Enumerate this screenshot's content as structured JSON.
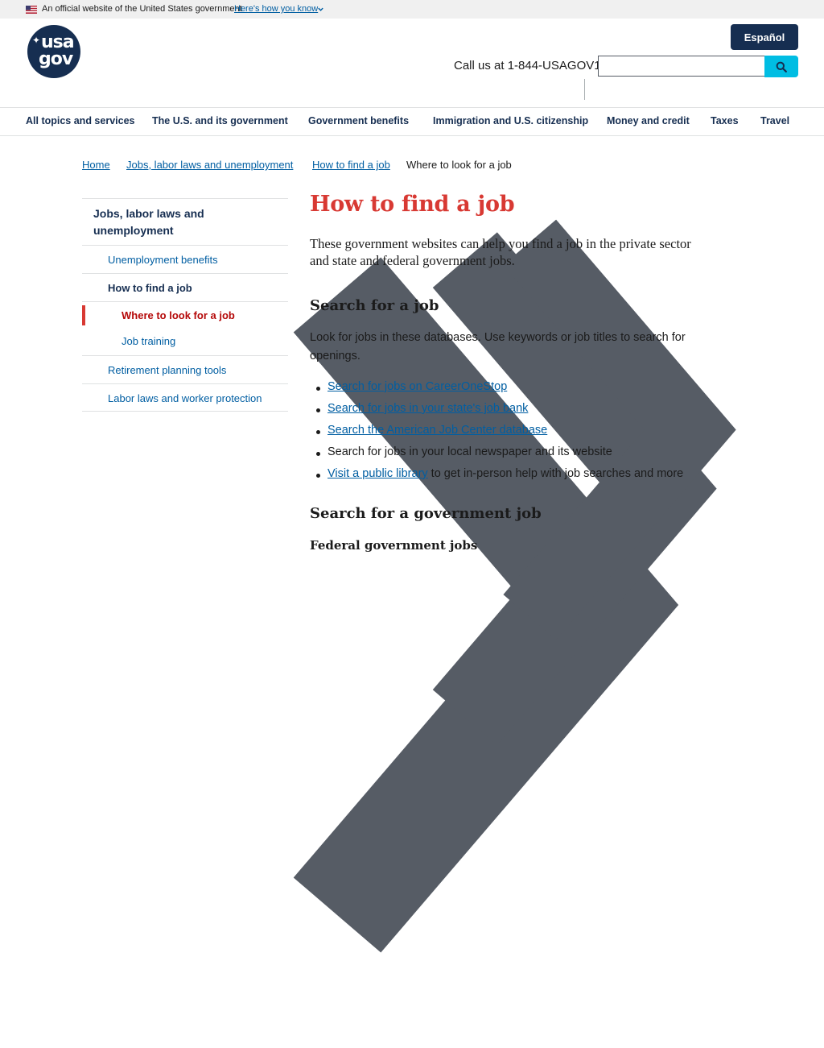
{
  "banner": {
    "official_text": "An official website of the United States government",
    "how_link": "Here's how you know"
  },
  "header": {
    "logo_top": "usa",
    "logo_bottom": "gov",
    "espanol_label": "Español",
    "call_text": "Call us at 1-844-USAGOV1",
    "search_value": ""
  },
  "nav": {
    "items": [
      "All topics and services",
      "The U.S. and its government",
      "Government benefits",
      "Immigration and U.S. citizenship",
      "Money and credit",
      "Taxes",
      "Travel"
    ]
  },
  "breadcrumb": {
    "items": [
      "Home",
      "Jobs, labor laws and unemployment",
      "How to find a job"
    ],
    "current": "Where to look for a job"
  },
  "sidebar": {
    "heading_line1": "Jobs, labor laws and",
    "heading_line2": "unemployment",
    "items": [
      "Unemployment benefits",
      "How to find a job",
      "Where to look for a job",
      "Job training",
      "Retirement planning tools",
      "Labor laws and worker protection"
    ]
  },
  "main": {
    "title": "How to find a job",
    "intro_line1": "These government websites can help you find a job in the private sector",
    "intro_line2": "and state and federal government jobs.",
    "section1_heading": "Search for a job",
    "section1_para_line1": "Look for jobs in these databases. Use keywords or job titles to search for",
    "section1_para_line2": "openings.",
    "list": [
      {
        "link": "Search for jobs on CareerOneStop",
        "rest": ""
      },
      {
        "link": "Search for jobs in your state's job bank",
        "rest": ""
      },
      {
        "link": "Search the American Job Center database",
        "rest": ""
      },
      {
        "link": "",
        "rest": "Search for jobs in your local newspaper and its website"
      },
      {
        "link": "Visit a public library",
        "rest": " to get in-person help with job searches and more"
      }
    ],
    "section2_heading": "Search for a government job",
    "section2_sub": "Federal government jobs"
  },
  "colors": {
    "navy": "#162e51",
    "link": "#005ea2",
    "accent_red": "#d83933",
    "search_button": "#00bde3"
  }
}
